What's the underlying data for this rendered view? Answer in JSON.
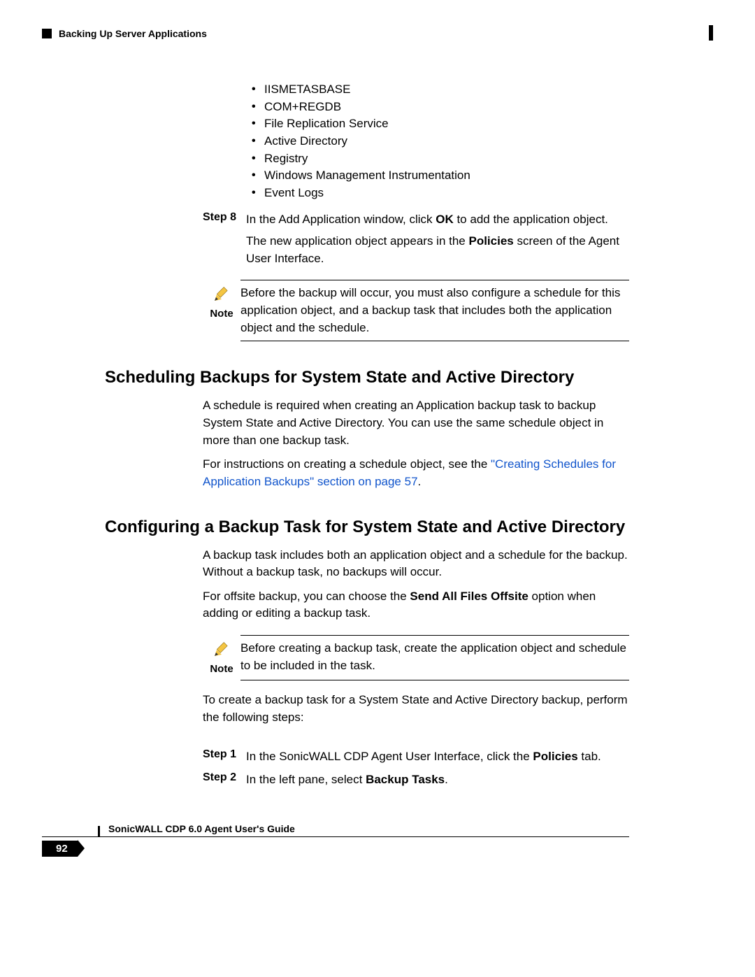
{
  "header": {
    "running_title": "Backing Up Server Applications"
  },
  "bullets": [
    "IISMETASBASE",
    "COM+REGDB",
    "File Replication Service",
    "Active Directory",
    "Registry",
    "Windows Management Instrumentation",
    "Event Logs"
  ],
  "step8": {
    "label": "Step 8",
    "line1_a": "In the Add Application window, click ",
    "line1_b": "OK",
    "line1_c": " to add the application object.",
    "line2_a": "The new application object appears in the ",
    "line2_b": "Policies",
    "line2_c": " screen of the Agent User Interface."
  },
  "note1": {
    "label": "Note",
    "text": "Before the backup will occur, you must also configure a schedule for this application object, and a backup task that includes both the application object and the schedule."
  },
  "section1": {
    "title": "Scheduling Backups for System State and Active Directory",
    "p1": "A schedule is required when creating an Application backup task to backup System State and Active Directory. You can use the same schedule object in more than one backup task.",
    "p2_a": "For instructions on creating a schedule object, see the ",
    "p2_link": "\"Creating Schedules for Application Backups\" section on page 57",
    "p2_c": "."
  },
  "section2": {
    "title": "Configuring a Backup Task for System State and Active Directory",
    "p1": "A backup task includes both an application object and a schedule for the backup. Without a backup task, no backups will occur.",
    "p2_a": "For offsite backup, you can choose the ",
    "p2_b": "Send All Files Offsite",
    "p2_c": " option when adding or editing a backup task."
  },
  "note2": {
    "label": "Note",
    "text": "Before creating a backup task, create the application object and schedule to be included in the task."
  },
  "section2b": {
    "p3": "To create a backup task for a System State and Active Directory backup, perform the following steps:"
  },
  "steps_bottom": {
    "s1_label": "Step 1",
    "s1_a": "In the SonicWALL CDP Agent User Interface, click the ",
    "s1_b": "Policies",
    "s1_c": " tab.",
    "s2_label": "Step 2",
    "s2_a": "In the left pane, select ",
    "s2_b": "Backup Tasks",
    "s2_c": "."
  },
  "footer": {
    "page_number": "92",
    "doc_title": "SonicWALL CDP 6.0 Agent User's Guide"
  }
}
